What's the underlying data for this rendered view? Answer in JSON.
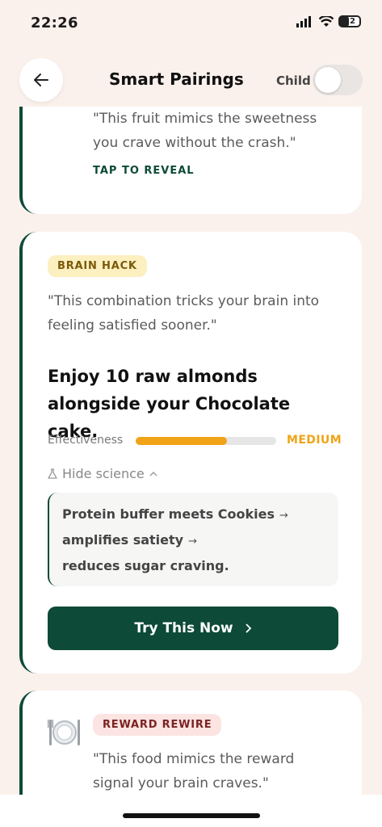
{
  "status": {
    "time": "22:26",
    "battery": "32"
  },
  "header": {
    "title": "Smart Pairings",
    "toggle_label": "Child"
  },
  "card1": {
    "quote": "\"This fruit mimics the sweetness you crave without the crash.\"",
    "tap_label": "TAP TO REVEAL"
  },
  "card2": {
    "badge": "BRAIN HACK",
    "quote": "\"This combination tricks your brain into feeling satisfied sooner.\"",
    "headline": "Enjoy 10 raw almonds alongside your Chocolate cake.",
    "effectiveness_label": "Effectiveness",
    "effectiveness_level": "MEDIUM",
    "effectiveness_value": 0.65,
    "hide_science": "Hide science",
    "science": [
      "Protein buffer meets Cookies",
      "amplifies satiety",
      "reduces sugar craving."
    ],
    "button_label": "Try This Now"
  },
  "card3": {
    "badge": "REWARD REWIRE",
    "quote": "\"This food mimics the reward signal your brain craves.\""
  },
  "colors": {
    "accent": "#0d4a37",
    "medium": "#f0a316",
    "background": "#fbf1ec"
  }
}
